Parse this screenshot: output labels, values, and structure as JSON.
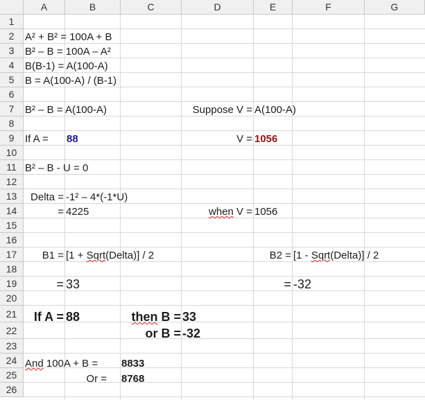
{
  "columns": [
    "A",
    "B",
    "C",
    "D",
    "E",
    "F",
    "G"
  ],
  "rows": [
    "1",
    "2",
    "3",
    "4",
    "5",
    "6",
    "7",
    "8",
    "9",
    "10",
    "11",
    "12",
    "13",
    "14",
    "15",
    "16",
    "17",
    "18",
    "19",
    "20",
    "21",
    "22",
    "23",
    "24",
    "25",
    "26"
  ],
  "cells": {
    "r2": "A² + B² = 100A + B",
    "r3": "B² – B = 100A – A²",
    "r4": "B(B-1) = A(100-A)",
    "r5": "B = A(100-A) / (B-1)",
    "r7a": "B² – B = A(100-A)",
    "r7d": "Suppose V =",
    "r7e": "A(100-A)",
    "r9a": "If A =",
    "r9b": "88",
    "r9d": "V =",
    "r9e": "1056",
    "r11": "B² – B - U = 0",
    "r13a": "Delta =",
    "r13b_pre": "-1² – 4*(-1*U)",
    "r14a": "=",
    "r14b": "4225",
    "r14d_when": "when",
    "r14d_rest": " V =",
    "r14e": "1056",
    "r17a": "B1 =",
    "r17b_1": "[1 + ",
    "r17b_sqrt": "Sqrt",
    "r17b_2": "(Delta)] / 2",
    "r17e": "B2 =",
    "r17e_1": "[1 - ",
    "r17e_sqrt": "Sqrt",
    "r17e_2": "(Delta)] / 2",
    "r19a": "=",
    "r19b": "33",
    "r19e": "=",
    "r19f": "-32",
    "r21a": "If A =",
    "r21b": "88",
    "r21c_then": "then",
    "r21c_rest": " B =",
    "r21d": "33",
    "r22c": "or B =",
    "r22d": "-32",
    "r24a_and": "And",
    "r24a_rest": " 100A + B =",
    "r24c": "8833",
    "r25a": "Or =",
    "r25c": "8768"
  }
}
